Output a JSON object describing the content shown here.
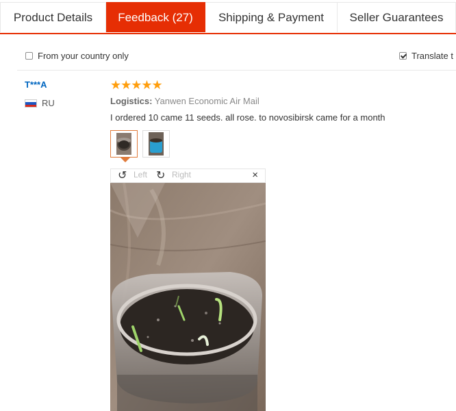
{
  "tabs": [
    {
      "label": "Product Details"
    },
    {
      "label": "Feedback (27)"
    },
    {
      "label": "Shipping & Payment"
    },
    {
      "label": "Seller Guarantees"
    }
  ],
  "filters": {
    "country_only": {
      "label": "From your country only",
      "checked": false
    },
    "translate": {
      "label": "Translate t",
      "checked": true
    }
  },
  "review": {
    "user": "T***A",
    "country": "RU",
    "rating_stars": "★★★★★",
    "logistics_label": "Logistics:",
    "logistics_value": "Yanwen Economic Air Mail",
    "text": "I ordered 10 came 11 seeds. all rose. to novosibirsk came for a month"
  },
  "viewer": {
    "rotate_left": "Left",
    "rotate_right": "Right",
    "close": "×"
  },
  "colors": {
    "accent": "#e62e04",
    "link": "#0066c0",
    "star": "#ff9e0d"
  }
}
